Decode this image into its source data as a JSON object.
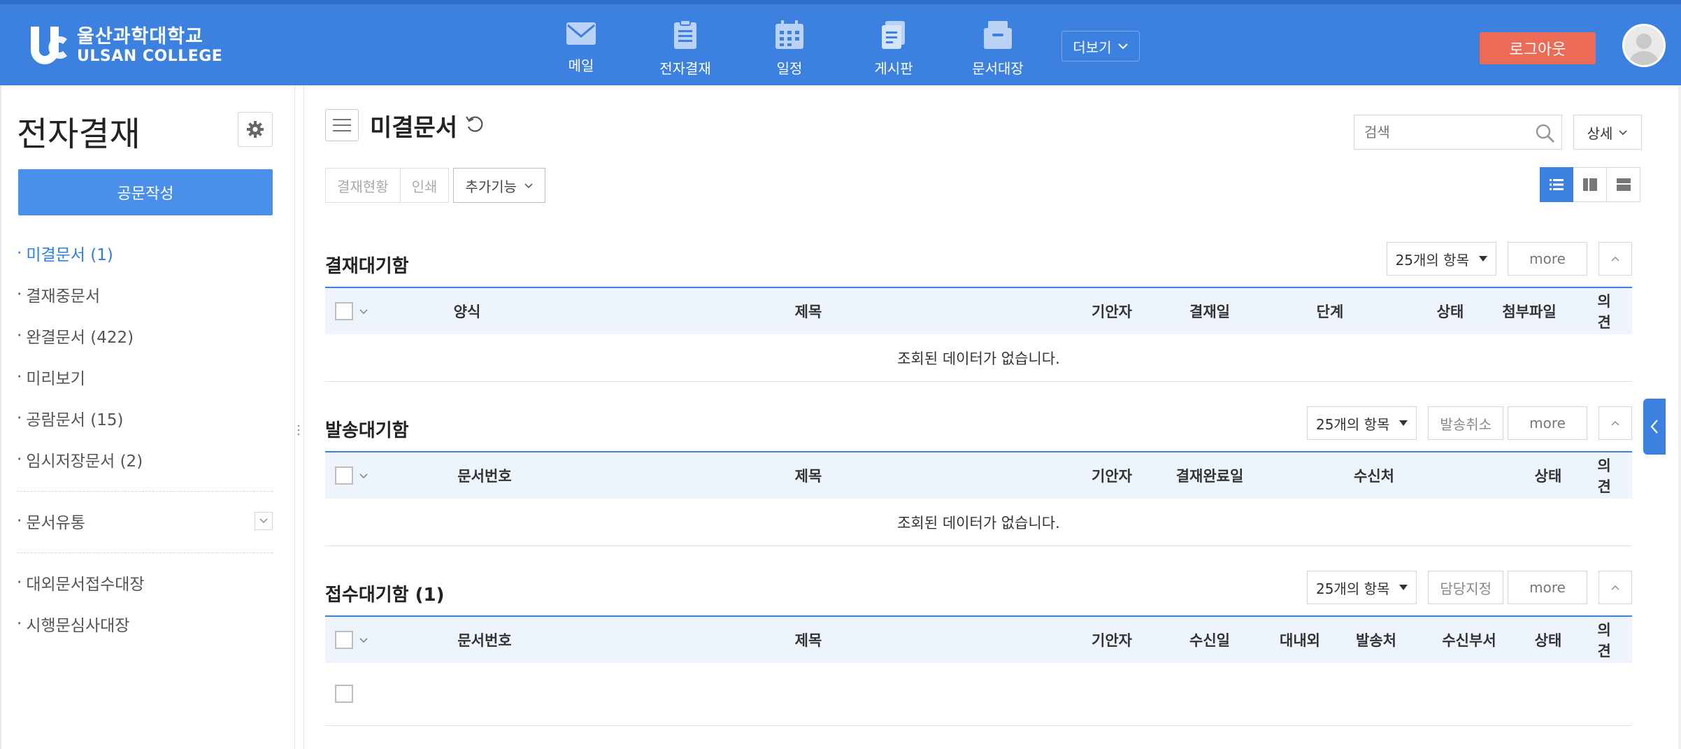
{
  "header": {
    "logo_ko": "울산과학대학교",
    "logo_en": "ULSAN COLLEGE",
    "nav": [
      {
        "label": "메일",
        "icon": "mail-icon"
      },
      {
        "label": "전자결재",
        "icon": "approval-icon"
      },
      {
        "label": "일정",
        "icon": "calendar-icon"
      },
      {
        "label": "게시판",
        "icon": "board-icon"
      },
      {
        "label": "문서대장",
        "icon": "archive-icon"
      }
    ],
    "more_label": "더보기",
    "logout_label": "로그아웃"
  },
  "sidebar": {
    "title": "전자결재",
    "compose_label": "공문작성",
    "items": [
      {
        "label": "미결문서 (1)",
        "active": true
      },
      {
        "label": "결재중문서"
      },
      {
        "label": "완결문서 (422)"
      },
      {
        "label": "미리보기"
      },
      {
        "label": "공람문서 (15)"
      },
      {
        "label": "임시저장문서 (2)"
      }
    ],
    "group_label": "문서유통",
    "extra_items": [
      {
        "label": "대외문서접수대장"
      },
      {
        "label": "시행문심사대장"
      }
    ]
  },
  "main": {
    "title": "미결문서",
    "search_placeholder": "검색",
    "detail_label": "상세",
    "toolbar": {
      "status_label": "결재현황",
      "print_label": "인쇄",
      "extra_label": "추가기능"
    }
  },
  "sections": [
    {
      "title": "결재대기함",
      "count_label": "25개의 항목",
      "more_label": "more",
      "columns": [
        "양식",
        "제목",
        "기안자",
        "결재일",
        "단계",
        "상태",
        "첨부파일",
        "의견"
      ],
      "empty_text": "조회된 데이터가 없습니다."
    },
    {
      "title": "발송대기함",
      "count_label": "25개의 항목",
      "action_label": "발송취소",
      "more_label": "more",
      "columns": [
        "문서번호",
        "제목",
        "기안자",
        "결재완료일",
        "수신처",
        "상태",
        "의견"
      ],
      "empty_text": "조회된 데이터가 없습니다."
    },
    {
      "title": "접수대기함 (1)",
      "count_label": "25개의 항목",
      "action_label": "담당지정",
      "more_label": "more",
      "columns": [
        "문서번호",
        "제목",
        "기안자",
        "수신일",
        "대내외",
        "발송처",
        "수신부서",
        "상태",
        "의견"
      ]
    }
  ],
  "colors": {
    "primary": "#3c81e0",
    "header_bg": "#3c81e0",
    "logout": "#ec6b57",
    "active_link": "#2f7ee6",
    "table_head_bg": "#eef4fc"
  }
}
